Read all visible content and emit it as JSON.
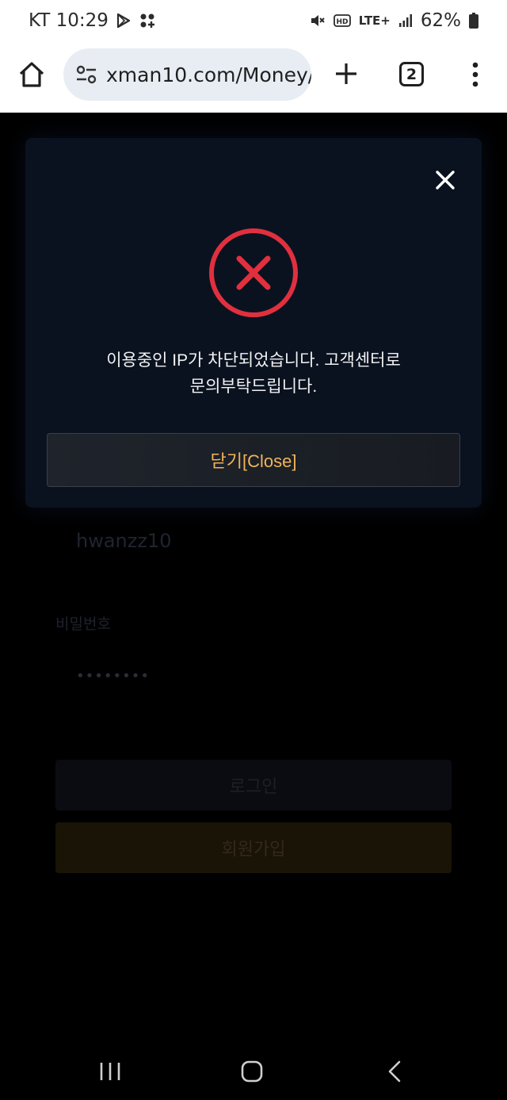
{
  "status_bar": {
    "carrier_time": "KT 10:29",
    "network": "LTE+",
    "battery": "62%"
  },
  "browser": {
    "url": "xman10.com/Money/",
    "tab_count": "2"
  },
  "background_form": {
    "username_value": "hwanzz10",
    "password_label": "비밀번호",
    "password_value": "••••••••",
    "login_button": "로그인",
    "signup_button": "회원가입"
  },
  "modal": {
    "message_line1": "이용중인 IP가 차단되었습니다. 고객센터로",
    "message_line2": "문의부탁드립니다.",
    "close_button": "닫기[Close]",
    "error_color": "#e0303e"
  }
}
